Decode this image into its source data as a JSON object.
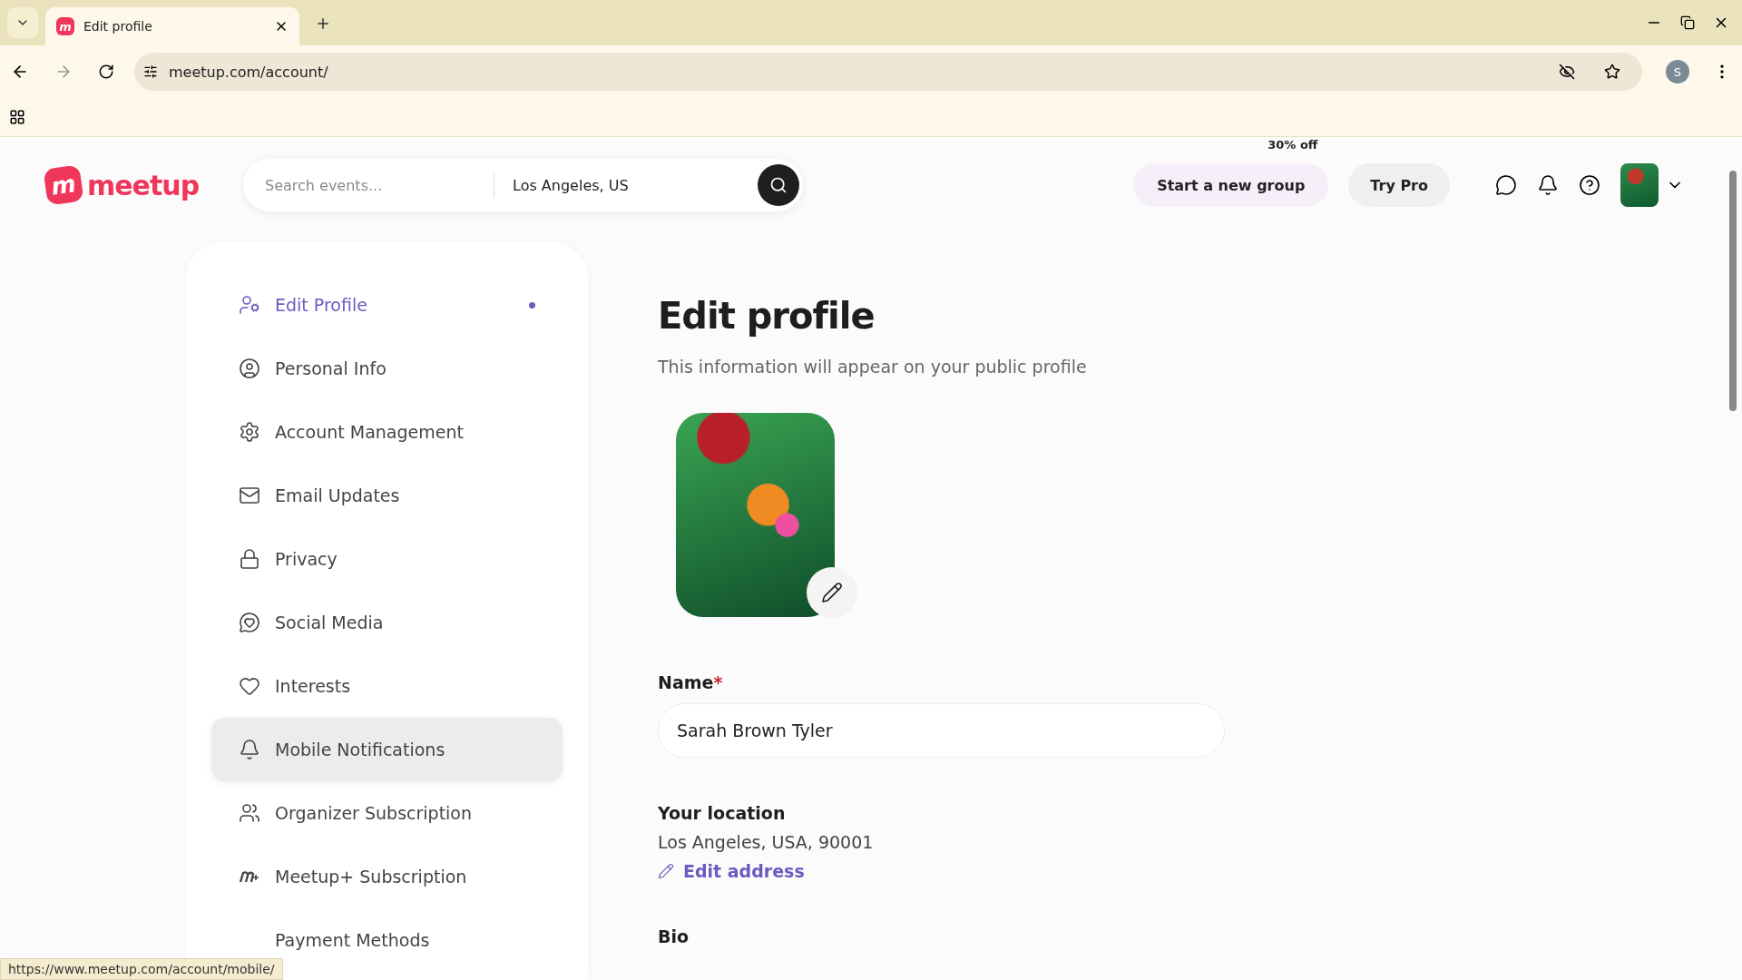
{
  "browser": {
    "tab": {
      "favicon": "m",
      "title": "Edit profile"
    },
    "address": "meetup.com/account/",
    "profile_initial": "S"
  },
  "header": {
    "logo": {
      "badge": "m",
      "text": "meetup"
    },
    "search": {
      "placeholder": "Search events...",
      "location": "Los Angeles, US"
    },
    "promo_badge": "30% off",
    "start_group": "Start a new group",
    "try_pro": "Try Pro"
  },
  "sidebar": {
    "items": [
      {
        "kind": "edit",
        "label": "Edit Profile",
        "selected": true,
        "hovered": false
      },
      {
        "kind": "person",
        "label": "Personal Info",
        "selected": false,
        "hovered": false
      },
      {
        "kind": "gear",
        "label": "Account Management",
        "selected": false,
        "hovered": false
      },
      {
        "kind": "mail",
        "label": "Email Updates",
        "selected": false,
        "hovered": false
      },
      {
        "kind": "lock",
        "label": "Privacy",
        "selected": false,
        "hovered": false
      },
      {
        "kind": "chat",
        "label": "Social Media",
        "selected": false,
        "hovered": false
      },
      {
        "kind": "heart",
        "label": "Interests",
        "selected": false,
        "hovered": false
      },
      {
        "kind": "bell",
        "label": "Mobile Notifications",
        "selected": false,
        "hovered": true
      },
      {
        "kind": "people",
        "label": "Organizer Subscription",
        "selected": false,
        "hovered": false
      },
      {
        "kind": "mplus",
        "label": "Meetup+ Subscription",
        "selected": false,
        "hovered": false
      },
      {
        "kind": "none",
        "label": "Payment Methods",
        "selected": false,
        "hovered": false
      }
    ]
  },
  "main": {
    "title": "Edit profile",
    "subtitle": "This information will appear on your public profile",
    "name": {
      "label": "Name",
      "required_mark": "*",
      "value": "Sarah Brown Tyler"
    },
    "location": {
      "label": "Your location",
      "value": "Los Angeles, USA, 90001",
      "edit_link": "Edit address"
    },
    "bio": {
      "label": "Bio"
    }
  },
  "status_url": "https://www.meetup.com/account/mobile/"
}
